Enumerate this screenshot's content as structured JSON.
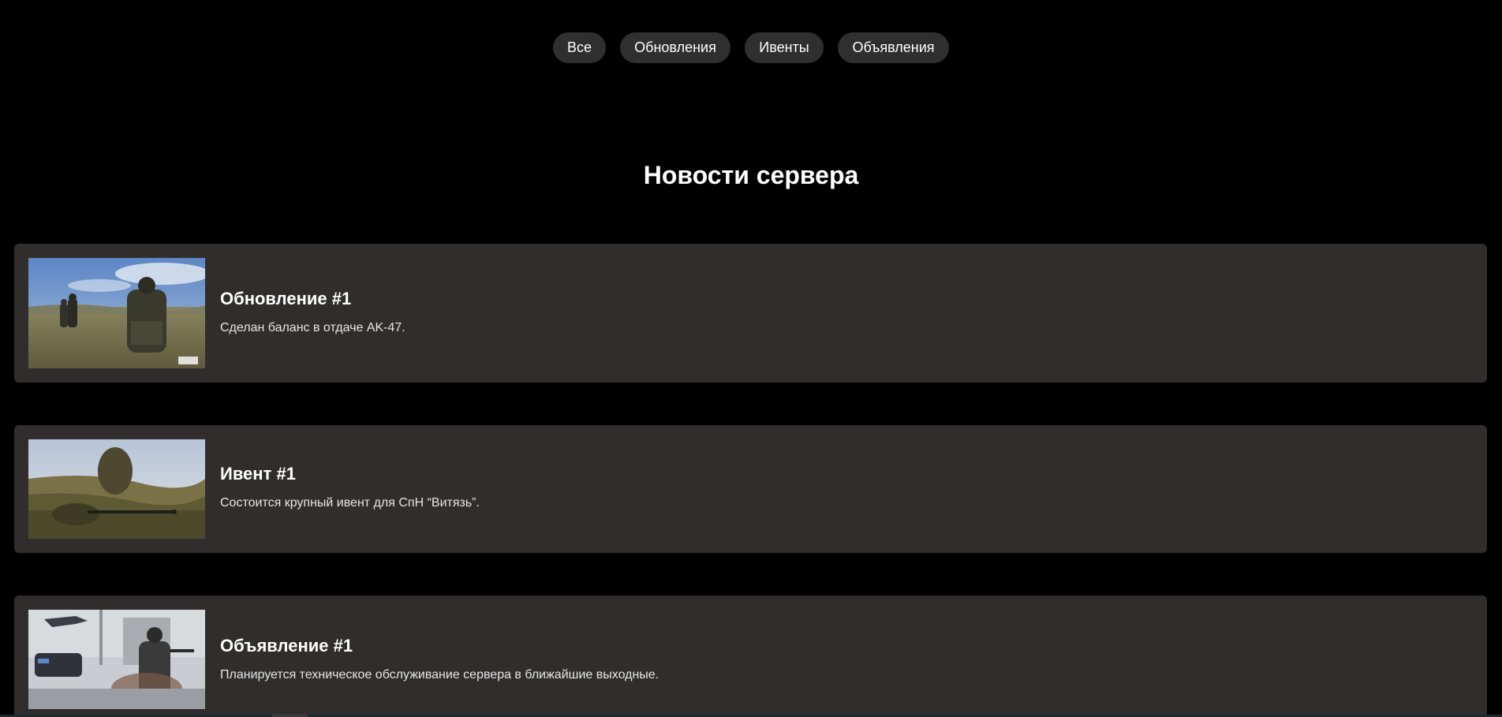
{
  "filters": {
    "all": "Все",
    "updates": "Обновления",
    "events": "Ивенты",
    "announcements": "Объявления"
  },
  "page_title": "Новости сервера",
  "news": [
    {
      "title": "Обновление #1",
      "description": "Сделан баланс в отдаче AK-47."
    },
    {
      "title": "Ивент #1",
      "description": "Состоится крупный ивент для СпН “Витязь”."
    },
    {
      "title": "Объявление #1",
      "description": "Планируется техническое обслуживание сервера в ближайшие выходные."
    }
  ],
  "colors": {
    "background": "#000000",
    "card": "#312d2d",
    "filter_button": "#2f2f2f",
    "text": "#ffffff"
  }
}
